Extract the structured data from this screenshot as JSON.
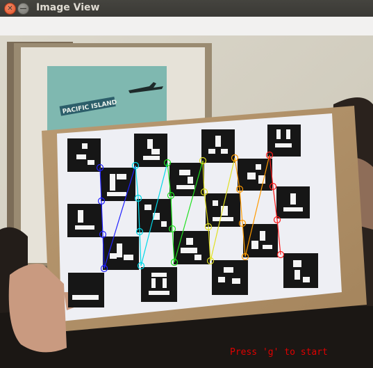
{
  "window": {
    "title": "Image View"
  },
  "buttons": {
    "close_glyph": "✕",
    "minimize_glyph": "—"
  },
  "image": {
    "status_text": "Press 'g' to start",
    "poster_text": "PACIFIC ISLAND"
  },
  "colors": {
    "titlebar": "#3c3b37",
    "title_text": "#dfdbd2",
    "toolbar": "#f2f1f0",
    "status_text": "#e00000",
    "corner_colors": [
      "#2020ff",
      "#00d8e8",
      "#20e020",
      "#e0e020",
      "#ff9a00",
      "#ff1a1a"
    ]
  }
}
